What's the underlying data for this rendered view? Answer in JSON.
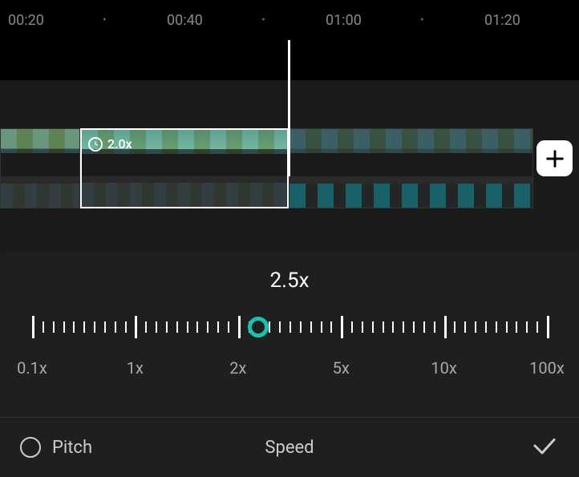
{
  "timeline": {
    "timestamps": [
      "00:20",
      "00:40",
      "01:00",
      "01:20"
    ],
    "clip_speed_badge": "2.0x"
  },
  "speed_control": {
    "current_value": "2.5x",
    "labels": [
      "0.1x",
      "1x",
      "2x",
      "5x",
      "10x",
      "100x"
    ],
    "handle_position_percent": 44
  },
  "bottom_bar": {
    "pitch_label": "Pitch",
    "panel_title": "Speed"
  },
  "colors": {
    "accent": "#1dbfaf"
  }
}
